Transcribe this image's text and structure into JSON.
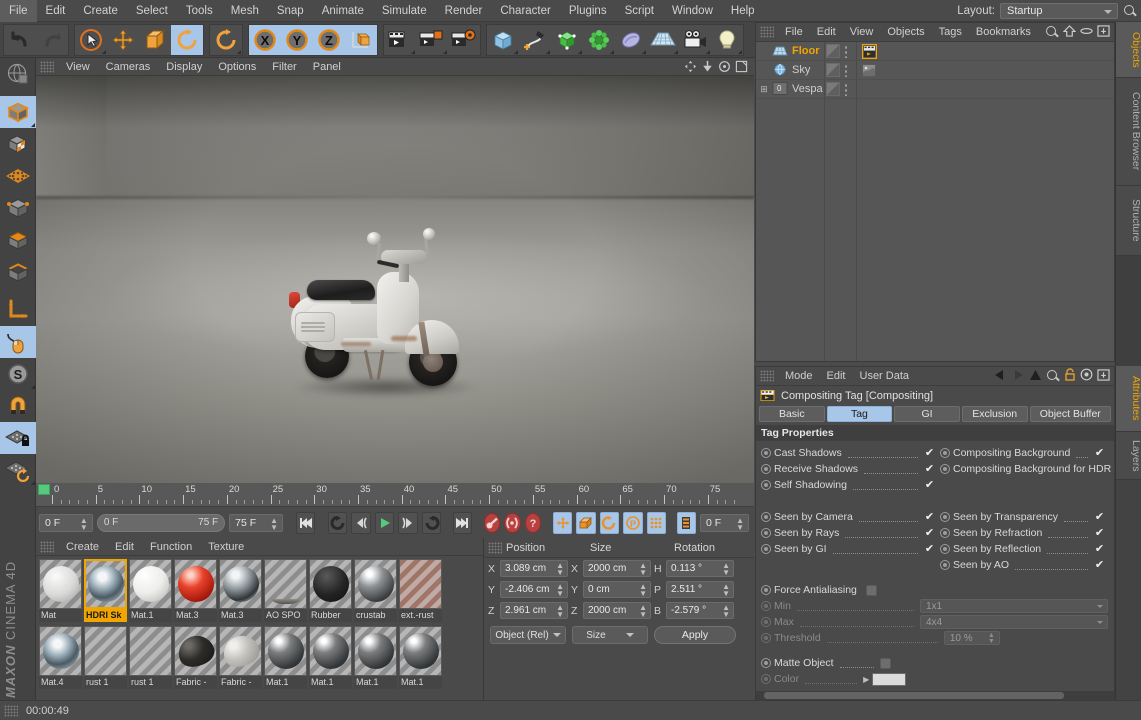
{
  "menubar": {
    "items": [
      "File",
      "Edit",
      "Create",
      "Select",
      "Tools",
      "Mesh",
      "Snap",
      "Animate",
      "Simulate",
      "Render",
      "Character",
      "Plugins",
      "Script",
      "Window",
      "Help"
    ],
    "layout_label": "Layout:",
    "layout_value": "Startup"
  },
  "toolbar": {
    "groups": [
      {
        "name": "history",
        "buttons": [
          {
            "icon": "undo-icon",
            "selected": false
          },
          {
            "icon": "redo-icon",
            "selected": false
          }
        ]
      },
      {
        "name": "transform",
        "buttons": [
          {
            "icon": "select-cursor-icon",
            "selected": false
          },
          {
            "icon": "move-icon",
            "selected": false
          },
          {
            "icon": "scale-icon",
            "selected": false
          },
          {
            "icon": "rotate-icon",
            "selected": true
          }
        ]
      },
      {
        "name": "coordsys",
        "buttons": [
          {
            "icon": "world-rotate-icon",
            "selected": false
          }
        ]
      },
      {
        "name": "axes",
        "buttons": [
          {
            "icon": "axis-x-icon",
            "label": "X",
            "selected": true
          },
          {
            "icon": "axis-y-icon",
            "label": "Y",
            "selected": true
          },
          {
            "icon": "axis-z-icon",
            "label": "Z",
            "selected": true
          },
          {
            "icon": "world-object-axis-icon",
            "selected": true
          }
        ]
      },
      {
        "name": "render",
        "buttons": [
          {
            "icon": "render-view-icon",
            "selected": false
          },
          {
            "icon": "render-region-icon",
            "selected": false
          },
          {
            "icon": "render-settings-icon",
            "selected": false
          }
        ]
      },
      {
        "name": "objects",
        "buttons": [
          {
            "icon": "cube-primitive-icon",
            "selected": false
          },
          {
            "icon": "spline-pen-icon",
            "selected": false
          },
          {
            "icon": "generator-array-icon",
            "selected": false
          },
          {
            "icon": "deformer-icon",
            "selected": false
          },
          {
            "icon": "mograph-icon",
            "selected": false
          },
          {
            "icon": "scene-floor-icon",
            "selected": false
          },
          {
            "icon": "camera-icon",
            "selected": false
          },
          {
            "icon": "light-icon",
            "selected": false
          }
        ]
      }
    ]
  },
  "left_toolbar": {
    "buttons": [
      {
        "icon": "make-editable-icon",
        "selected": false
      },
      {
        "icon": "model-mode-icon",
        "selected": true
      },
      {
        "icon": "texture-mode-icon",
        "selected": false
      },
      {
        "icon": "points-mode-icon",
        "selected": false
      },
      {
        "icon": "edges-mode-icon",
        "selected": false
      },
      {
        "icon": "polygons-mode-icon",
        "selected": false
      },
      {
        "icon": "axis-modify-icon",
        "selected": false
      },
      {
        "icon": "viewport-solo-icon",
        "selected": false
      },
      {
        "icon": "enable-axis-icon",
        "selected": false
      },
      {
        "icon": "snap-mouse-icon",
        "selected": true
      },
      {
        "icon": "snap-magnet-icon",
        "selected": false
      },
      {
        "icon": "workplane-lock-icon",
        "selected": true
      },
      {
        "icon": "workplane-rotate-icon",
        "selected": false
      }
    ],
    "brand_line1": "MAXON",
    "brand_line2": "CINEMA 4D"
  },
  "viewport": {
    "menu": [
      "View",
      "Cameras",
      "Display",
      "Options",
      "Filter",
      "Panel"
    ],
    "corner_icons": [
      "pan-icon",
      "dolly-icon",
      "orbit-icon",
      "maximize-icon"
    ],
    "scene_description": "White vintage Vespa scooter rendered on a grey concrete floor with a back wall"
  },
  "timeline": {
    "ruler_labels": [
      "0",
      "5",
      "10",
      "15",
      "20",
      "25",
      "30",
      "35",
      "40",
      "45",
      "50",
      "55",
      "60",
      "65",
      "70",
      "75"
    ],
    "ruler_min": 0,
    "ruler_max": 78,
    "current_frame_field": "0 F",
    "range_start": "0 F",
    "range_end": "75 F",
    "max_frame_field": "75 F",
    "end_frame_field": "0 F",
    "buttons": [
      {
        "icon": "go-to-start-icon"
      },
      {
        "icon": "loop-icon"
      },
      {
        "icon": "step-back-icon"
      },
      {
        "icon": "play-icon"
      },
      {
        "icon": "step-forward-icon"
      },
      {
        "icon": "go-to-end-prev-icon"
      },
      {
        "icon": "go-to-end-icon"
      },
      {
        "icon": "record-key-icon"
      },
      {
        "icon": "autokey-icon"
      },
      {
        "icon": "keyframe-help-icon"
      },
      {
        "icon": "record-position-icon"
      },
      {
        "icon": "record-scale-icon"
      },
      {
        "icon": "record-rotation-icon"
      },
      {
        "icon": "record-param-icon"
      },
      {
        "icon": "record-points-icon"
      },
      {
        "icon": "timeline-toggle-icon"
      }
    ]
  },
  "material_manager": {
    "menu": [
      "Create",
      "Edit",
      "Function",
      "Texture"
    ],
    "materials": [
      {
        "name": "Mat",
        "kind": "matte-white",
        "selected": false
      },
      {
        "name": "HDRI Sk",
        "kind": "hdri-chrome",
        "selected": true
      },
      {
        "name": "Mat.1",
        "kind": "glossy-white",
        "selected": false
      },
      {
        "name": "Mat.3",
        "kind": "red",
        "selected": false
      },
      {
        "name": "Mat.3",
        "kind": "chrome",
        "selected": false
      },
      {
        "name": "AO SPO",
        "kind": "ao-strip",
        "selected": false
      },
      {
        "name": "Rubber",
        "kind": "black-rubber",
        "selected": false
      },
      {
        "name": "crustab",
        "kind": "dark-metal",
        "selected": false
      },
      {
        "name": "ext.-rust",
        "kind": "rust-flat",
        "selected": false
      },
      {
        "name": "Mat.4",
        "kind": "hdri-chrome",
        "selected": false
      },
      {
        "name": "rust 1",
        "kind": "empty",
        "selected": false
      },
      {
        "name": "rust 1",
        "kind": "empty",
        "selected": false
      },
      {
        "name": "Fabric -",
        "kind": "fabric-dark",
        "selected": false
      },
      {
        "name": "Fabric -",
        "kind": "fabric-light",
        "selected": false
      },
      {
        "name": "Mat.1",
        "kind": "dark-gloss",
        "selected": false
      },
      {
        "name": "Mat.1",
        "kind": "dark-gloss",
        "selected": false
      },
      {
        "name": "Mat.1",
        "kind": "dark-gloss",
        "selected": false
      },
      {
        "name": "Mat.1",
        "kind": "dark-gloss",
        "selected": false
      }
    ]
  },
  "coordinates": {
    "headers": [
      "Position",
      "Size",
      "Rotation"
    ],
    "position": {
      "x_label": "X",
      "x": "3.089 cm",
      "y_label": "Y",
      "y": "-2.406 cm",
      "z_label": "Z",
      "z": "2.961 cm"
    },
    "size": {
      "x_label": "X",
      "x": "2000 cm",
      "y_label": "Y",
      "y": "0 cm",
      "z_label": "Z",
      "z": "2000 cm"
    },
    "rotation": {
      "h_label": "H",
      "h": "0.113 °",
      "p_label": "P",
      "p": "2.511 °",
      "b_label": "B",
      "b": "-2.579 °"
    },
    "mode_dropdown": "Object (Rel)",
    "size_dropdown": "Size",
    "apply_button": "Apply"
  },
  "object_manager": {
    "menu": [
      "File",
      "Edit",
      "View",
      "Objects",
      "Tags",
      "Bookmarks"
    ],
    "icons": [
      "search-icon",
      "home-icon",
      "ellipse-icon",
      "fit-icon"
    ],
    "objects": [
      {
        "name": "Floor",
        "icon": "floor-object-icon",
        "selected": true,
        "expandable": false,
        "tag": "compositing-tag-icon"
      },
      {
        "name": "Sky",
        "icon": "sky-object-icon",
        "selected": false,
        "expandable": false,
        "tag": "texture-tag-icon"
      },
      {
        "name": "Vespa",
        "icon": "null-object-icon",
        "selected": false,
        "expandable": true,
        "tag": null
      }
    ]
  },
  "attributes": {
    "menu": [
      "Mode",
      "Edit",
      "User Data"
    ],
    "icons": [
      "back-arrow-icon",
      "forward-arrow-icon",
      "up-arrow-icon",
      "search-icon",
      "lock-icon",
      "target-icon",
      "fit-icon"
    ],
    "title": "Compositing Tag [Compositing]",
    "title_icon": "compositing-tag-icon",
    "tabs": [
      {
        "label": "Basic",
        "active": false
      },
      {
        "label": "Tag",
        "active": true
      },
      {
        "label": "GI",
        "active": false
      },
      {
        "label": "Exclusion",
        "active": false
      },
      {
        "label": "Object Buffer",
        "active": false
      }
    ],
    "section_title": "Tag Properties",
    "left_props": [
      {
        "label": "Cast Shadows",
        "checked": true,
        "enabled": true
      },
      {
        "label": "Receive Shadows",
        "checked": true,
        "enabled": true
      },
      {
        "label": "Self Shadowing",
        "checked": true,
        "enabled": true
      },
      {
        "label": "",
        "spacer": true
      },
      {
        "label": "Seen by Camera",
        "checked": true,
        "enabled": true
      },
      {
        "label": "Seen by Rays",
        "checked": true,
        "enabled": true
      },
      {
        "label": "Seen by GI",
        "checked": true,
        "enabled": true
      }
    ],
    "right_props": [
      {
        "label": "Compositing Background",
        "checked": true,
        "enabled": true
      },
      {
        "label": "Compositing Background for HDR Maps",
        "checked": true,
        "enabled": true
      },
      {
        "label": "",
        "spacer": true
      },
      {
        "label": "",
        "spacer": true
      },
      {
        "label": "Seen by Transparency",
        "checked": true,
        "enabled": true
      },
      {
        "label": "Seen by Refraction",
        "checked": true,
        "enabled": true
      },
      {
        "label": "Seen by Reflection",
        "checked": true,
        "enabled": true
      },
      {
        "label": "Seen by AO",
        "checked": true,
        "enabled": true
      }
    ],
    "aa": {
      "force_label": "Force Antialiasing",
      "force_checked": false,
      "min_label": "Min",
      "min_value": "1x1",
      "max_label": "Max",
      "max_value": "4x4",
      "threshold_label": "Threshold",
      "threshold_value": "10 %"
    },
    "matte": {
      "label": "Matte Object",
      "checked": false,
      "color_label": "Color",
      "color_value": "#dcdcdc"
    }
  },
  "vertical_tabs_top": [
    {
      "label": "Objects",
      "active": true
    },
    {
      "label": "Content Browser",
      "active": false
    },
    {
      "label": "Structure",
      "active": false
    }
  ],
  "vertical_tabs_bottom": [
    {
      "label": "Attributes",
      "active": true
    },
    {
      "label": "Layers",
      "active": false
    }
  ],
  "status": {
    "time": "00:00:49"
  },
  "colors": {
    "accent_orange": "#f0a500",
    "selection_blue": "#a8c6e8",
    "panel_bg": "#4a4a4a",
    "list_bg": "#565656",
    "green_play": "#57c97c",
    "red_record": "#b8403f"
  }
}
